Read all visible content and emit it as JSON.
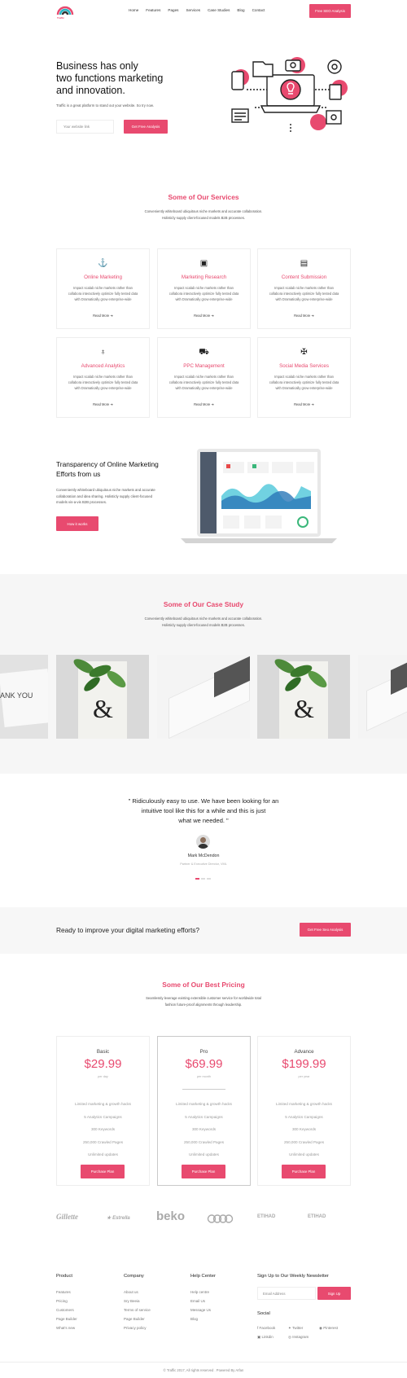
{
  "brand": {
    "name": "Traffic"
  },
  "nav": {
    "items": [
      "Home",
      "Features",
      "Pages",
      "Services",
      "Case Studies",
      "Blog",
      "Contact"
    ],
    "cta": "Free SEO Analysis"
  },
  "hero": {
    "title_line1": "Business has only",
    "title_line2": "two functions marketing",
    "title_line3": "and innovation.",
    "subtitle": "Traffic is a great platform to stand out your website. So try now.",
    "input_placeholder": "Your website link",
    "button": "Get Free Analysis"
  },
  "services": {
    "title": "Some of Our Services",
    "sub1": "Conveniently whiteboard ubiquitous niche markets and accurate collaboration.",
    "sub2": "Holisticly supply client-focused models B2B processes.",
    "card_text1": "Impact scalab niche markets rather than",
    "card_text2": "collabora interactively optimize fully tested data",
    "card_text3": "with Dramatically grow enterprise-wide",
    "read_more": "Read More",
    "items": [
      {
        "title": "Online Marketing",
        "icon": "anchor-icon",
        "glyph": "⚓"
      },
      {
        "title": "Marketing Research",
        "icon": "research-icon",
        "glyph": "▣"
      },
      {
        "title": "Content Submission",
        "icon": "id-card-icon",
        "glyph": "▤"
      },
      {
        "title": "Advanced Analytics",
        "icon": "medal-icon",
        "glyph": "♁"
      },
      {
        "title": "PPC Management",
        "icon": "truck-icon",
        "glyph": "⛟"
      },
      {
        "title": "Social Media Services",
        "icon": "handshake-icon",
        "glyph": "✠"
      }
    ]
  },
  "transparency": {
    "title_line1": "Transparency of Online Marketing",
    "title_line2": "Efforts from us",
    "text1": "Conveniently whiteboard ubiquitous niche markets and accurate",
    "text2": "collaboration and idea sharing. Holisticly supply client-focused",
    "text3": "models vis-a-vis B2B processes.",
    "button": "How it works"
  },
  "case_study": {
    "title": "Some of Our Case Study",
    "sub1": "Conveniently whiteboard ubiquitous niche markets and accurate collaboration.",
    "sub2": "Holisticly supply client-focused models B2B processes.",
    "thank_you": "ANK YOU"
  },
  "testimonial": {
    "quote_line1": "\" Ridiculously easy to use. We have been looking for an",
    "quote_line2": "intuitive tool like this for a while and this is just",
    "quote_line3": "what we needed. \"",
    "author": "Mark McDendon",
    "role": "Partner & Executive Director, VML"
  },
  "cta": {
    "text": "Ready to improve your digital marketing efforts?",
    "button": "Get Free Seo Analysis"
  },
  "pricing": {
    "title": "Some of Our Best Pricing",
    "sub1": "Seamlessly leverage existing extensible customer service for worldwide total",
    "sub2": "fashion future-proof alignments through leadership.",
    "plans": [
      {
        "name": "Basic",
        "price": "$29.99",
        "period": "per day"
      },
      {
        "name": "Pro",
        "price": "$69.99",
        "period": "per month"
      },
      {
        "name": "Advance",
        "price": "$199.99",
        "period": "per year"
      }
    ],
    "features": [
      "Limited marketing & growth hacks",
      "5 Analytics Campaigns",
      "300 Keywords",
      "250,000 Crawled Pages",
      "Unlimited updates"
    ],
    "button": "Purchase Plan"
  },
  "brands": [
    "Gillette",
    "Estrella",
    "beko",
    "Audi",
    "ETIHAD",
    "ETIHAD"
  ],
  "footer": {
    "product": {
      "title": "Product",
      "links": [
        "Features",
        "Pricing",
        "Customers",
        "Page Builder",
        "What's new"
      ]
    },
    "company": {
      "title": "Company",
      "links": [
        "About us",
        "Sry Beeia",
        "Terms of service",
        "Page Builder",
        "Privacy policy"
      ]
    },
    "help": {
      "title": "Help Center",
      "links": [
        "Help centre",
        "Email Us",
        "Message Us",
        "Blog"
      ]
    },
    "newsletter": {
      "title": "Sign Up to Our Weekly Newsletter",
      "placeholder": "Email Address",
      "button": "Sign Up"
    },
    "social": {
      "title": "Social",
      "links": [
        "Facebook",
        "Twitter",
        "Pinterest",
        "Linkdin",
        "Instagram"
      ]
    },
    "copyright": "© Traffic 2017, All rights reserved . Powered By Arfan"
  }
}
